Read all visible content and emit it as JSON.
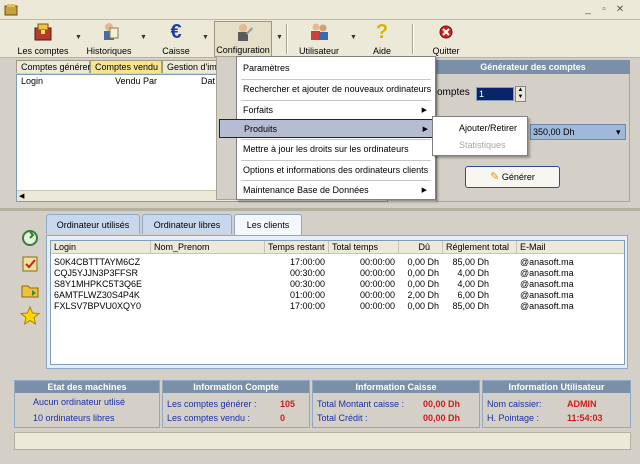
{
  "toolbar": {
    "items": [
      {
        "label": "Les comptes",
        "icon": "accounts-icon"
      },
      {
        "label": "Historiques",
        "icon": "history-icon"
      },
      {
        "label": "Caisse",
        "icon": "euro-icon"
      },
      {
        "label": "Configuration",
        "icon": "configuration-icon"
      },
      {
        "label": "Utilisateur",
        "icon": "users-icon"
      },
      {
        "label": "Aide",
        "icon": "help-icon"
      },
      {
        "label": "Quitter",
        "icon": "exit-icon"
      }
    ]
  },
  "top_tabs": [
    "Comptes générer",
    "Comptes vendu",
    "Gestion d'imp"
  ],
  "list_columns": [
    "Login",
    "Vendu Par",
    "Dat"
  ],
  "generator": {
    "title": "Générateur des comptes",
    "count_label": "omptes",
    "count_value": "1",
    "price": "350,00 Dh",
    "generate_label": "Générer"
  },
  "config_menu": {
    "items": [
      {
        "label": "Paramètres",
        "has_submenu": false
      },
      {
        "label": "Rechercher et ajouter de nouveaux ordinateurs",
        "has_submenu": false
      },
      {
        "label": "Forfaits",
        "has_submenu": true
      },
      {
        "label": "Produits",
        "has_submenu": true,
        "highlighted": true
      },
      {
        "label": "Mettre à jour les droits sur les ordinateurs",
        "has_submenu": false
      },
      {
        "label": "Options et informations des ordinateurs clients",
        "has_submenu": false
      },
      {
        "label": "Maintenance Base de Données",
        "has_submenu": true
      }
    ],
    "submenu": [
      {
        "label": "Ajouter/Retirer",
        "enabled": true
      },
      {
        "label": "Statistiques",
        "enabled": false
      }
    ]
  },
  "bottom_tabs": [
    "Ordinateur utilisés",
    "Ordinateur libres",
    "Les clients"
  ],
  "clients_grid": {
    "columns": [
      "Login",
      "Nom_Prenom",
      "Temps restant",
      "Total temps",
      "Dû",
      "Réglement total",
      "E-Mail"
    ],
    "rows": [
      [
        "S0K4CBTTTAYM6CZ",
        "",
        "17:00:00",
        "00:00:00",
        "0,00 Dh",
        "85,00 Dh",
        "@anasoft.ma"
      ],
      [
        "CQJ5YJJN3P3FFSR",
        "",
        "00:30:00",
        "00:00:00",
        "0,00 Dh",
        "4,00 Dh",
        "@anasoft.ma"
      ],
      [
        "S8Y1MHPKC5T3Q6E",
        "",
        "00:30:00",
        "00:00:00",
        "0,00 Dh",
        "4,00 Dh",
        "@anasoft.ma"
      ],
      [
        "6AMTFLWZ30S4P4K",
        "",
        "01:00:00",
        "00:00:00",
        "2,00 Dh",
        "6,00 Dh",
        "@anasoft.ma"
      ],
      [
        "FXLSV7BPVU0XQY0",
        "",
        "17:00:00",
        "00:00:00",
        "0,00 Dh",
        "85,00 Dh",
        "@anasoft.ma"
      ]
    ]
  },
  "status": {
    "machines": {
      "title": "Etat des machines",
      "line1": "Aucun ordinateur utlisé",
      "line2": "10 ordinateurs libres"
    },
    "compte": {
      "title": "Information Compte",
      "label1": "Les comptes générer :",
      "value1": "105",
      "label2": "Les comptes vendu :",
      "value2": "0"
    },
    "caisse": {
      "title": "Information Caisse",
      "label1": "Total Montant caisse :",
      "value1": "00,00 Dh",
      "label2": "Total Crédit :",
      "value2": "00,00 Dh"
    },
    "utilisateur": {
      "title": "Information Utilisateur",
      "label1": "Nom caissier:",
      "value1": "ADMIN",
      "label2": "H. Pointage :",
      "value2": "11:54:03"
    }
  },
  "colors": {
    "header_blue": "#7b8fa8",
    "value_red": "#d11b1b",
    "text_blue": "#1c2fa8"
  }
}
